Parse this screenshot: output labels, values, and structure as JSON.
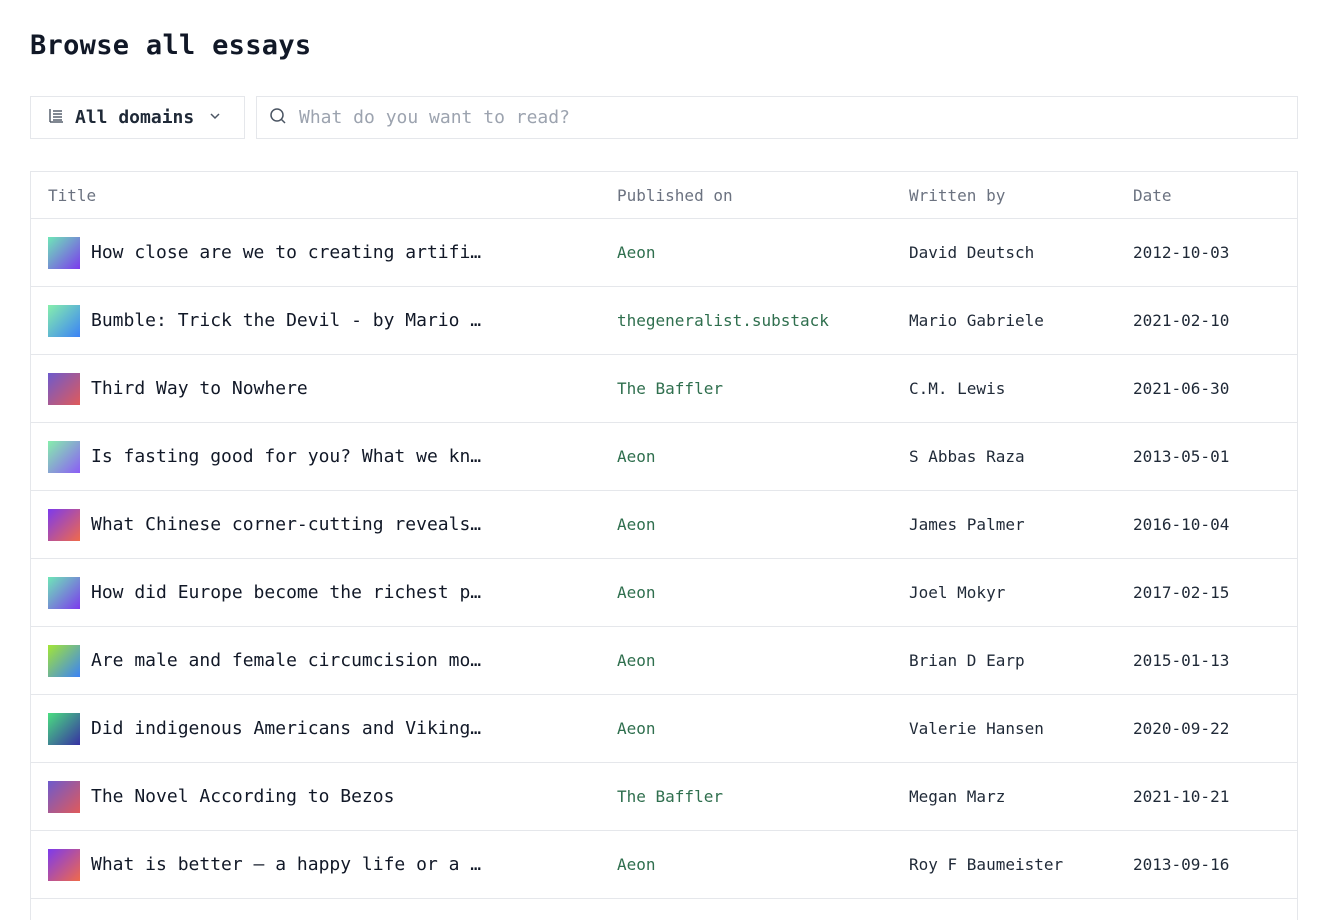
{
  "page": {
    "title": "Browse all essays"
  },
  "filters": {
    "domain_label": "All domains",
    "domain_icon": "list-filter-icon",
    "domain_chevron": "chevron-down-icon",
    "search_icon": "search-icon",
    "search_placeholder": "What do you want to read?",
    "search_value": ""
  },
  "table": {
    "columns": [
      "Title",
      "Published on",
      "Written by",
      "Date"
    ],
    "rows": [
      {
        "title": "How close are we to creating artificial intelligence?",
        "publisher": "Aeon",
        "author": "David Deutsch",
        "date": "2012-10-03",
        "thumb": [
          "#6ee7b7",
          "#7c3aed"
        ]
      },
      {
        "title": "Bumble: Trick the Devil - by Mario Gabriele",
        "publisher": "thegeneralist.substack",
        "author": "Mario Gabriele",
        "date": "2021-02-10",
        "thumb": [
          "#86efac",
          "#3b82f6"
        ]
      },
      {
        "title": "Third Way to Nowhere",
        "publisher": "The Baffler",
        "author": "C.M. Lewis",
        "date": "2021-06-30",
        "thumb": [
          "#6d5acd",
          "#e05a5a"
        ]
      },
      {
        "title": "Is fasting good for you? What we know",
        "publisher": "Aeon",
        "author": "S Abbas Raza",
        "date": "2013-05-01",
        "thumb": [
          "#86efac",
          "#8b5cf6"
        ]
      },
      {
        "title": "What Chinese corner-cutting reveals about modernity",
        "publisher": "Aeon",
        "author": "James Palmer",
        "date": "2016-10-04",
        "thumb": [
          "#7c3aed",
          "#f06a4a"
        ]
      },
      {
        "title": "How did Europe become the richest part of the world?",
        "publisher": "Aeon",
        "author": "Joel Mokyr",
        "date": "2017-02-15",
        "thumb": [
          "#6ee7b7",
          "#7c3aed"
        ]
      },
      {
        "title": "Are male and female circumcision morally equivalent?",
        "publisher": "Aeon",
        "author": "Brian D Earp",
        "date": "2015-01-13",
        "thumb": [
          "#a3e635",
          "#3b82f6"
        ]
      },
      {
        "title": "Did indigenous Americans and Vikings meet?",
        "publisher": "Aeon",
        "author": "Valerie Hansen",
        "date": "2020-09-22",
        "thumb": [
          "#4ade80",
          "#3730a3"
        ]
      },
      {
        "title": "The Novel According to Bezos",
        "publisher": "The Baffler",
        "author": "Megan Marz",
        "date": "2021-10-21",
        "thumb": [
          "#6d5acd",
          "#e05a5a"
        ]
      },
      {
        "title": "What is better – a happy life or a meaningful one?",
        "publisher": "Aeon",
        "author": "Roy F Baumeister",
        "date": "2013-09-16",
        "thumb": [
          "#7c3aed",
          "#f06a4a"
        ]
      }
    ]
  }
}
